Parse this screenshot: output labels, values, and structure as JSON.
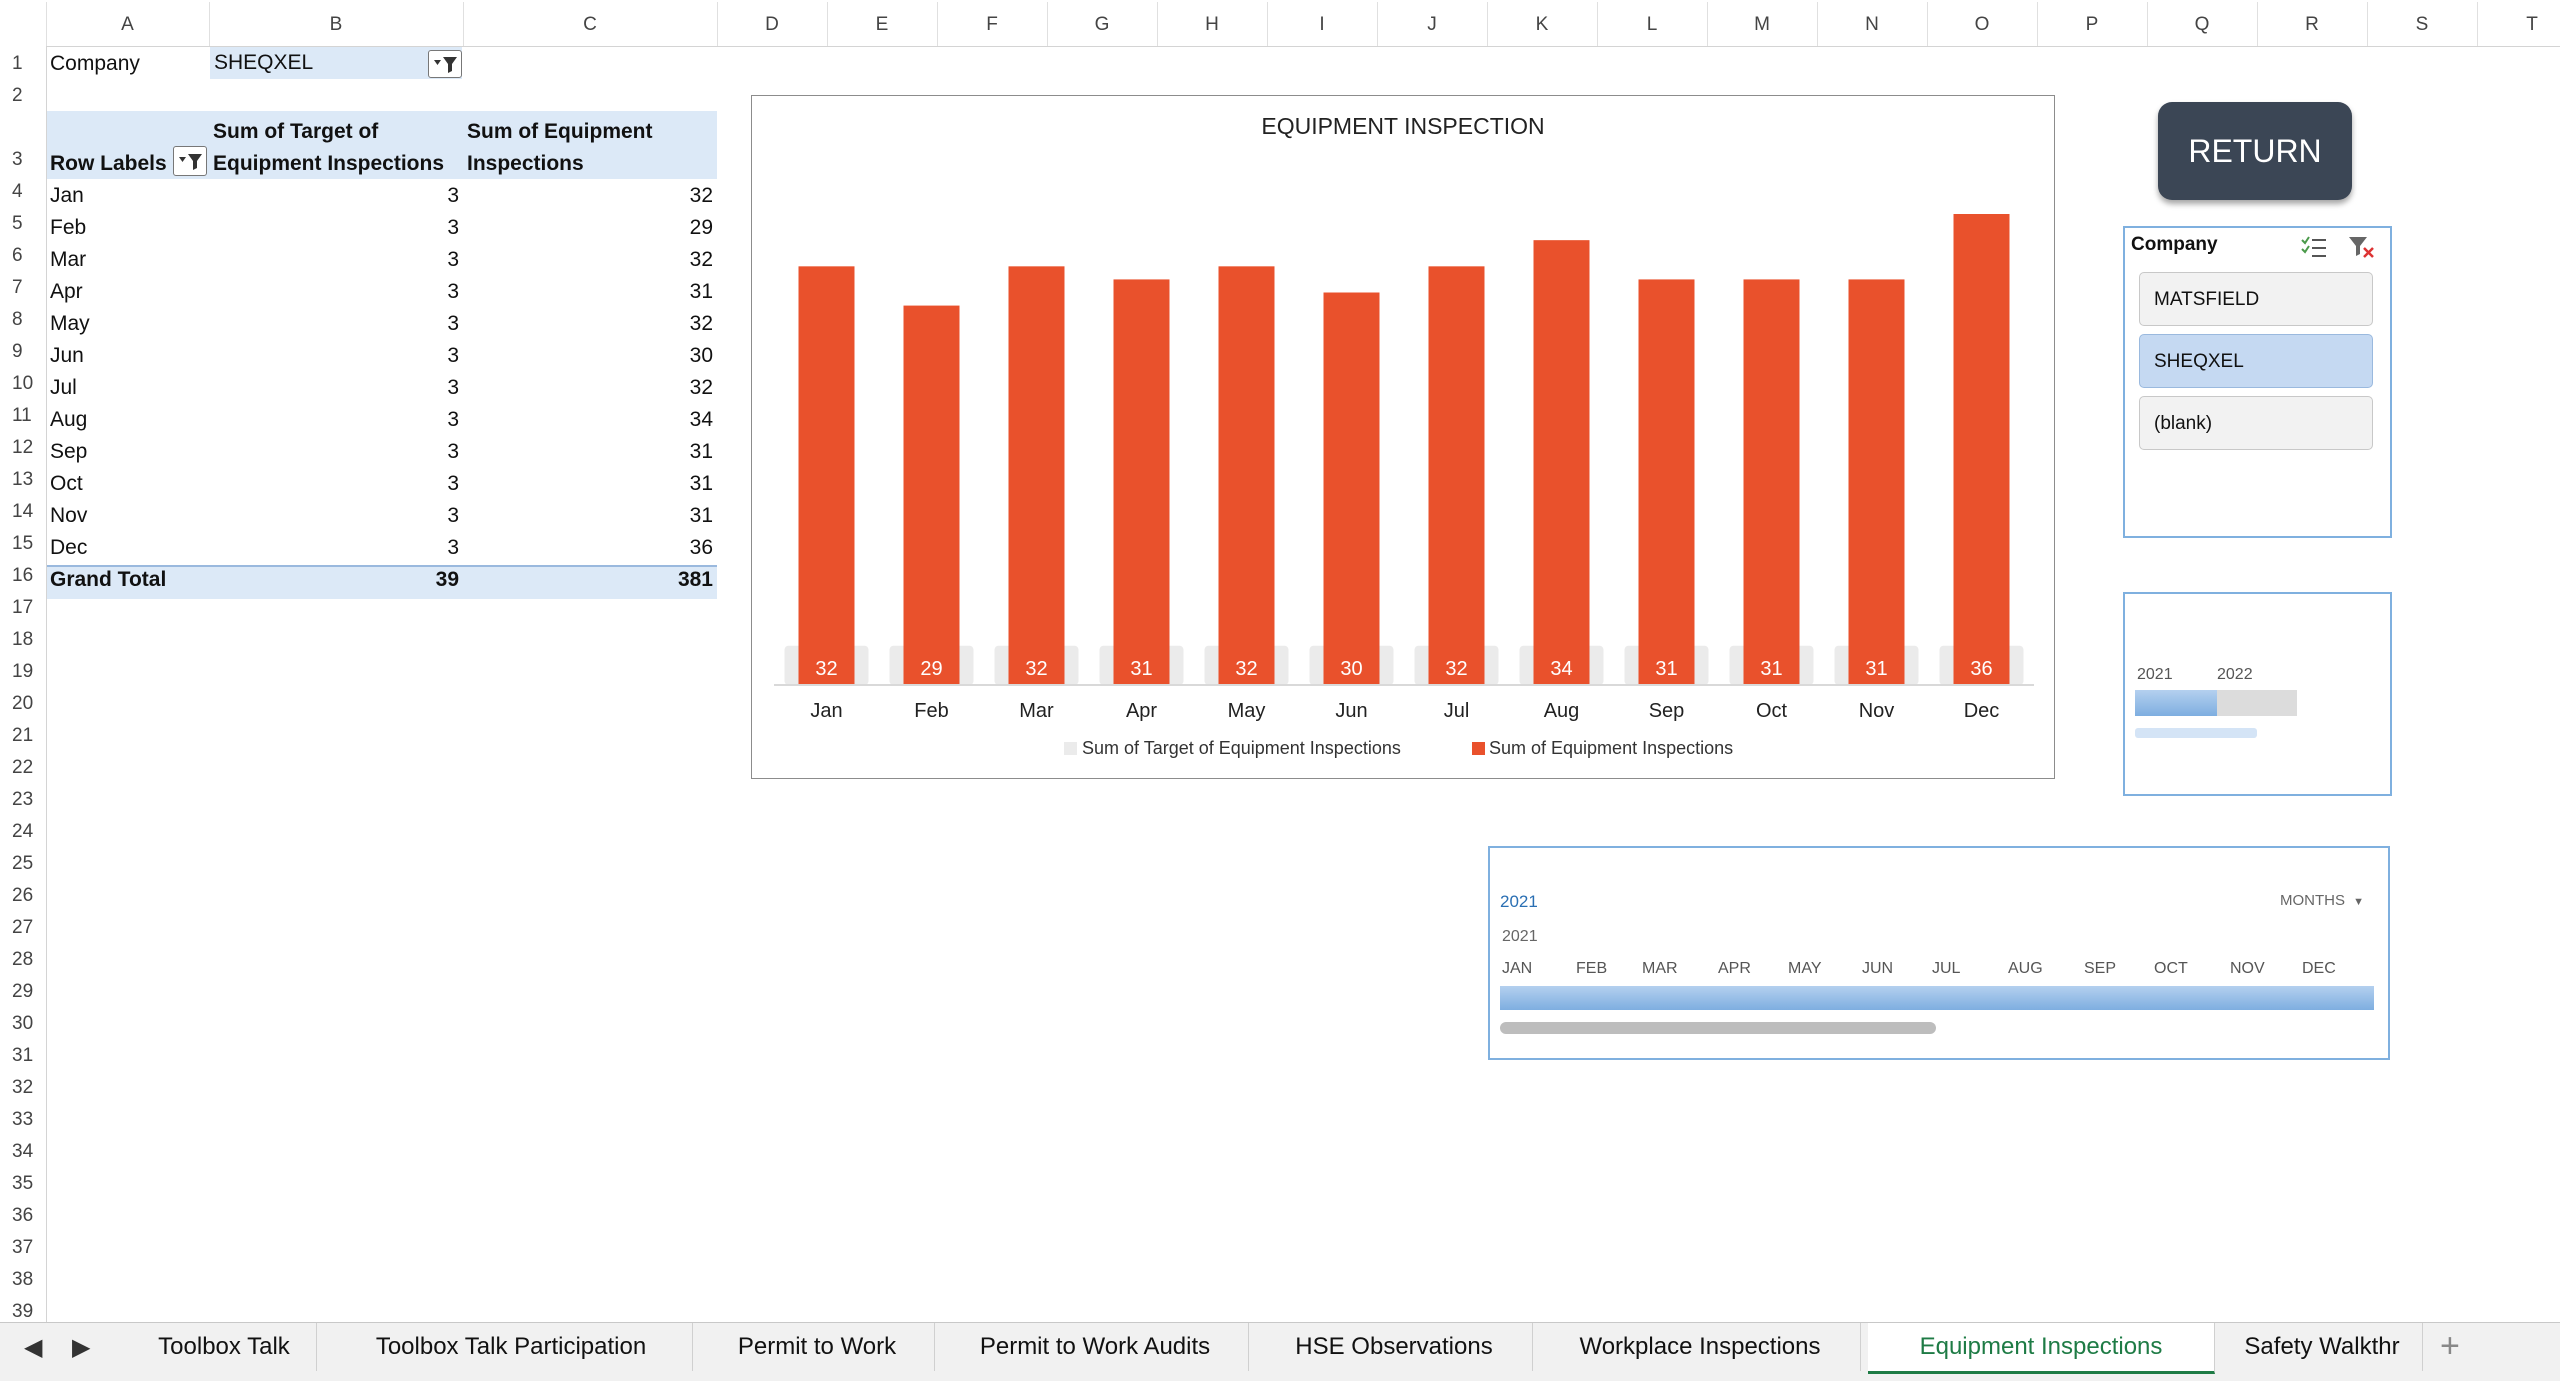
{
  "columns": [
    "A",
    "B",
    "C",
    "D",
    "E",
    "F",
    "G",
    "H",
    "I",
    "J",
    "K",
    "L",
    "M",
    "N",
    "O",
    "P",
    "Q",
    "R",
    "S",
    "T"
  ],
  "rows": [
    "1",
    "2",
    "3",
    "4",
    "5",
    "6",
    "7",
    "8",
    "9",
    "10",
    "11",
    "12",
    "13",
    "14",
    "15",
    "16",
    "17",
    "18",
    "19",
    "20",
    "21",
    "22",
    "23",
    "24",
    "25",
    "26",
    "27",
    "28",
    "29",
    "30",
    "31",
    "32",
    "33",
    "34",
    "35",
    "36",
    "37",
    "38",
    "39"
  ],
  "filter": {
    "label": "Company",
    "value": "SHEQXEL"
  },
  "pivot": {
    "row_labels_header": "Row Labels",
    "col_b_header_1": "Sum of Target of",
    "col_b_header_2": "Equipment Inspections",
    "col_c_header_1": "Sum of Equipment",
    "col_c_header_2": "Inspections",
    "rows": [
      {
        "month": "Jan",
        "target": "3",
        "actual": "32"
      },
      {
        "month": "Feb",
        "target": "3",
        "actual": "29"
      },
      {
        "month": "Mar",
        "target": "3",
        "actual": "32"
      },
      {
        "month": "Apr",
        "target": "3",
        "actual": "31"
      },
      {
        "month": "May",
        "target": "3",
        "actual": "32"
      },
      {
        "month": "Jun",
        "target": "3",
        "actual": "30"
      },
      {
        "month": "Jul",
        "target": "3",
        "actual": "32"
      },
      {
        "month": "Aug",
        "target": "3",
        "actual": "34"
      },
      {
        "month": "Sep",
        "target": "3",
        "actual": "31"
      },
      {
        "month": "Oct",
        "target": "3",
        "actual": "31"
      },
      {
        "month": "Nov",
        "target": "3",
        "actual": "31"
      },
      {
        "month": "Dec",
        "target": "3",
        "actual": "36"
      }
    ],
    "grand_total_label": "Grand Total",
    "grand_total_target": "39",
    "grand_total_actual": "381"
  },
  "chart_data": {
    "type": "bar",
    "title": "EQUIPMENT INSPECTION",
    "categories": [
      "Jan",
      "Feb",
      "Mar",
      "Apr",
      "May",
      "Jun",
      "Jul",
      "Aug",
      "Sep",
      "Oct",
      "Nov",
      "Dec"
    ],
    "series": [
      {
        "name": "Sum of Target of Equipment Inspections",
        "values": [
          3,
          3,
          3,
          3,
          3,
          3,
          3,
          3,
          3,
          3,
          3,
          3
        ],
        "color": "#ebebeb"
      },
      {
        "name": "Sum of Equipment Inspections",
        "values": [
          32,
          29,
          32,
          31,
          32,
          30,
          32,
          34,
          31,
          31,
          31,
          36
        ],
        "color": "#e9512c"
      }
    ],
    "data_labels": true,
    "legend": "bottom",
    "grid": false
  },
  "return_button": {
    "label": "RETURN"
  },
  "slicer": {
    "title": "Company",
    "items": [
      {
        "label": "MATSFIELD",
        "selected": false
      },
      {
        "label": "SHEQXEL",
        "selected": true
      },
      {
        "label": "(blank)",
        "selected": false
      }
    ]
  },
  "mini_timeline": {
    "years": [
      "2021",
      "2022"
    ]
  },
  "timeline": {
    "selection_label": "2021",
    "level_label": "MONTHS",
    "year_label": "2021",
    "months": [
      "JAN",
      "FEB",
      "MAR",
      "APR",
      "MAY",
      "JUN",
      "JUL",
      "AUG",
      "SEP",
      "OCT",
      "NOV",
      "DEC"
    ]
  },
  "tabs": [
    {
      "label": "Toolbox Talk"
    },
    {
      "label": "Toolbox Talk Participation"
    },
    {
      "label": "Permit to Work"
    },
    {
      "label": "Permit to Work Audits"
    },
    {
      "label": "HSE Observations"
    },
    {
      "label": "Workplace Inspections"
    },
    {
      "label": "Equipment Inspections",
      "active": true
    },
    {
      "label": "Safety Walkthr"
    }
  ],
  "colors": {
    "bar": "#e9512c",
    "target_bar": "#ebebeb",
    "header_fill": "#dce9f7",
    "active_tab": "#1e7b45",
    "slicer_border": "#7fb0df"
  }
}
